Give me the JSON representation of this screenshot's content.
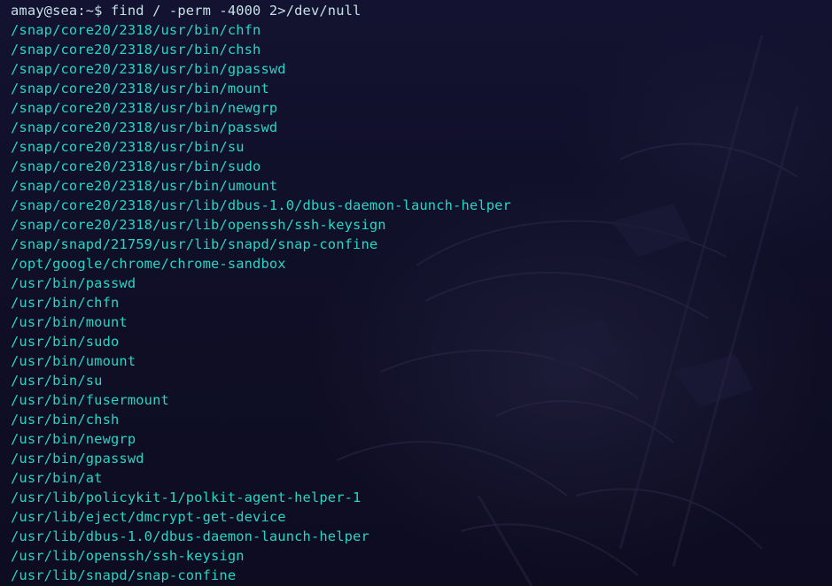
{
  "terminal": {
    "prompt": "amay@sea:~$ find / -perm -4000 2>/dev/null",
    "output": [
      "/snap/core20/2318/usr/bin/chfn",
      "/snap/core20/2318/usr/bin/chsh",
      "/snap/core20/2318/usr/bin/gpasswd",
      "/snap/core20/2318/usr/bin/mount",
      "/snap/core20/2318/usr/bin/newgrp",
      "/snap/core20/2318/usr/bin/passwd",
      "/snap/core20/2318/usr/bin/su",
      "/snap/core20/2318/usr/bin/sudo",
      "/snap/core20/2318/usr/bin/umount",
      "/snap/core20/2318/usr/lib/dbus-1.0/dbus-daemon-launch-helper",
      "/snap/core20/2318/usr/lib/openssh/ssh-keysign",
      "/snap/snapd/21759/usr/lib/snapd/snap-confine",
      "/opt/google/chrome/chrome-sandbox",
      "/usr/bin/passwd",
      "/usr/bin/chfn",
      "/usr/bin/mount",
      "/usr/bin/sudo",
      "/usr/bin/umount",
      "/usr/bin/su",
      "/usr/bin/fusermount",
      "/usr/bin/chsh",
      "/usr/bin/newgrp",
      "/usr/bin/gpasswd",
      "/usr/bin/at",
      "/usr/lib/policykit-1/polkit-agent-helper-1",
      "/usr/lib/eject/dmcrypt-get-device",
      "/usr/lib/dbus-1.0/dbus-daemon-launch-helper",
      "/usr/lib/openssh/ssh-keysign",
      "/usr/lib/snapd/snap-confine"
    ]
  },
  "colors": {
    "background": "#100f26",
    "prompt_text": "#c5e1e6",
    "output_text": "#27d6c4"
  }
}
